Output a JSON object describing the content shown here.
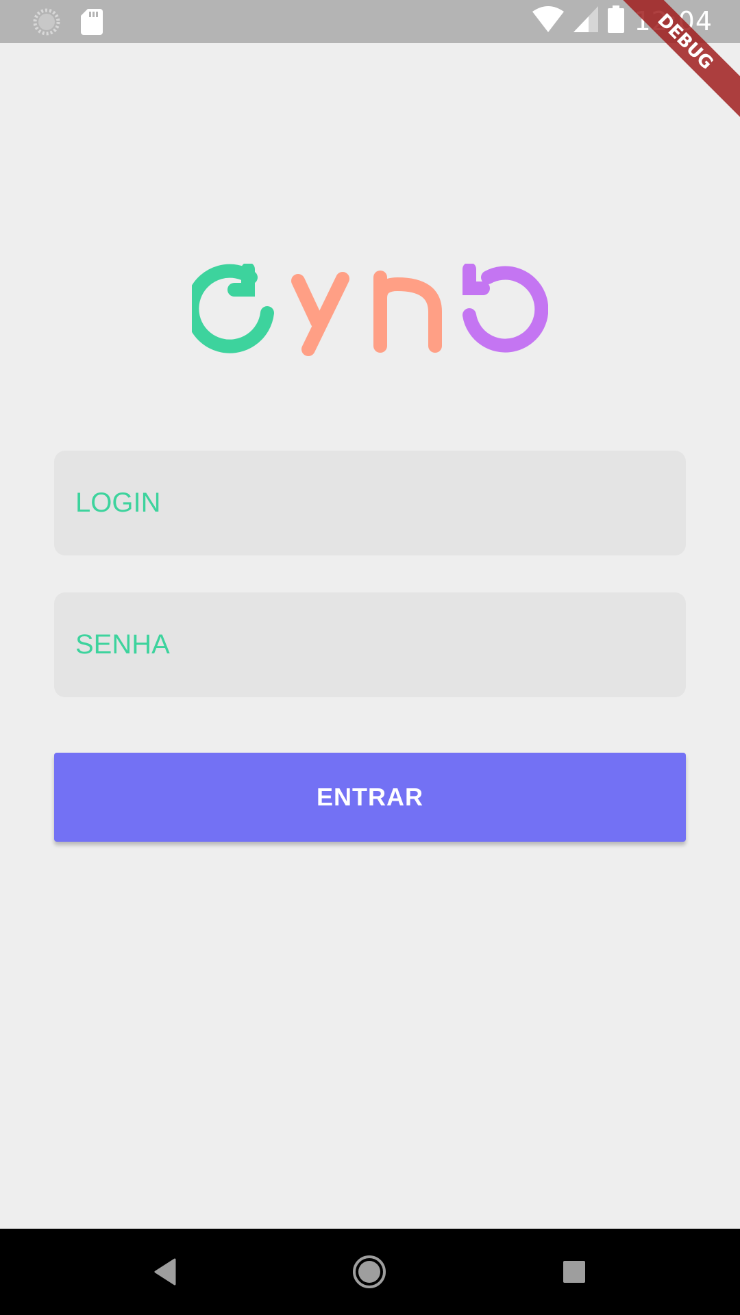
{
  "status_bar": {
    "time": "12:04",
    "icons": [
      "sync-icon",
      "sd-card-icon",
      "wifi-icon",
      "signal-icon",
      "battery-icon"
    ]
  },
  "debug_banner": {
    "label": "DEBUG"
  },
  "logo": {
    "text": "cyno",
    "colors": {
      "c": "#3dd39d",
      "y": "#ff9f85",
      "n": "#ff9f85",
      "o": "#c475f2"
    }
  },
  "form": {
    "login": {
      "placeholder": "LOGIN",
      "value": ""
    },
    "senha": {
      "placeholder": "SENHA",
      "value": ""
    },
    "submit_label": "ENTRAR"
  },
  "theme": {
    "background": "#eeeeee",
    "field_background": "#e4e4e4",
    "placeholder_color": "#3dd39d",
    "button_color": "#7371f4",
    "status_bar_color": "#b4b4b4"
  },
  "nav_bar": {
    "buttons": [
      "back-icon",
      "home-icon",
      "recent-apps-icon"
    ]
  }
}
